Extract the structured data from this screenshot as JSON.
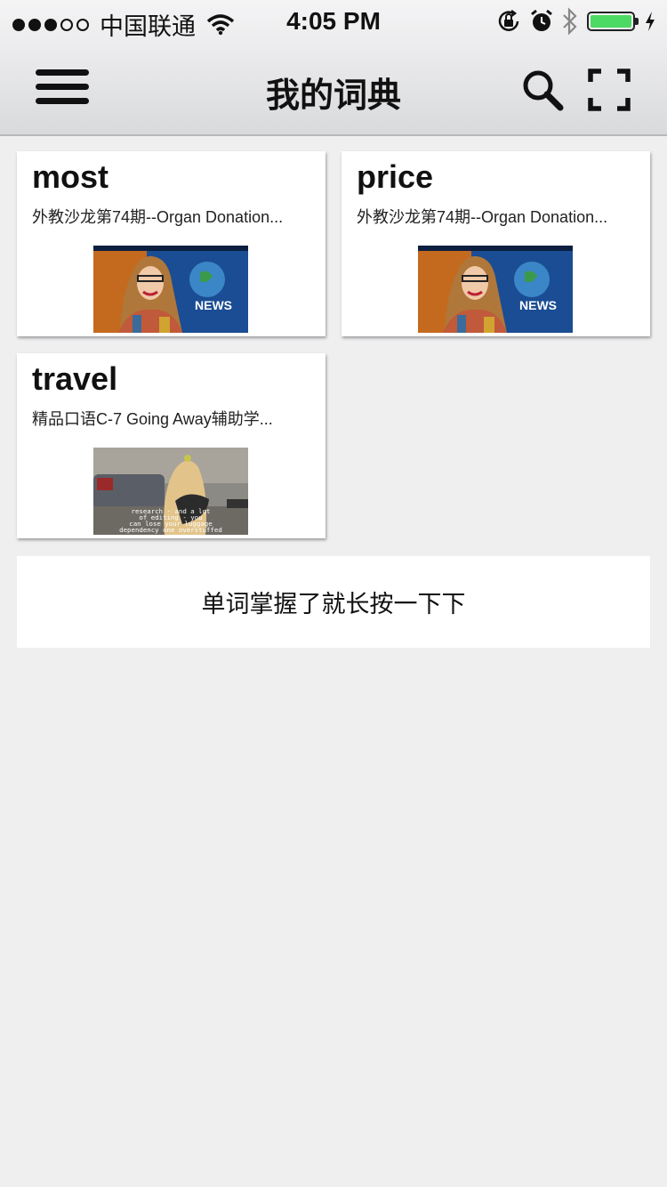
{
  "status_bar": {
    "signal_dots_filled": 3,
    "signal_dots_total": 5,
    "carrier": "中国联通",
    "time": "4:05 PM",
    "battery_level": 1.0,
    "icons": [
      "wifi-icon",
      "orientation-lock-icon",
      "alarm-icon",
      "bluetooth-icon",
      "battery-icon",
      "charging-icon"
    ]
  },
  "navbar": {
    "title": "我的词典",
    "left_icon": "menu-icon",
    "right_icons": [
      "search-icon",
      "scan-icon"
    ]
  },
  "cards": [
    {
      "word": "most",
      "source": "外教沙龙第74期--Organ Donation...",
      "thumbnail": "news-anchor"
    },
    {
      "word": "price",
      "source": "外教沙龙第74期--Organ Donation...",
      "thumbnail": "news-anchor"
    },
    {
      "word": "travel",
      "source": "精品口语C-7 Going Away辅助学...",
      "thumbnail": "living-room",
      "subtitle_lines": [
        "research - and a lot",
        "of editing - you",
        "can lose your luggage",
        "dependency one overstuffed"
      ]
    }
  ],
  "hint": "单词掌握了就长按一下下",
  "colors": {
    "background": "#efeff0",
    "battery": "#4cd964",
    "news_blue": "#1a4d93"
  }
}
